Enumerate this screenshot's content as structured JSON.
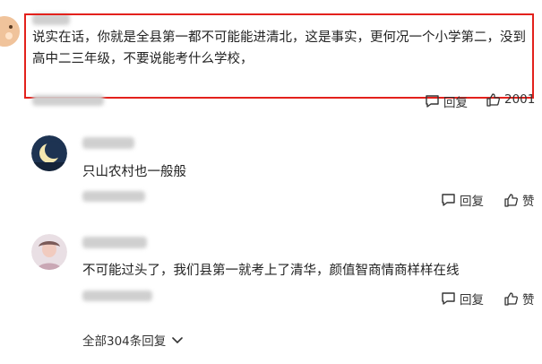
{
  "top_comment": {
    "text_line1": "说实在话，你就是全县第一都不可能能进清北，这是事实，更何况一个小学第二，没到",
    "text_line2": "高中二三年级，不要说能考什么学校，",
    "reply_label": "回复",
    "like_count": "2001"
  },
  "replies": [
    {
      "text": "只山农村也一般般",
      "reply_label": "回复",
      "like_label": "赞"
    },
    {
      "text": "不可能过头了，我们县第一就考上了清华，颜值智商情商样样在线",
      "reply_label": "回复",
      "like_label": "赞"
    }
  ],
  "more_replies": {
    "label": "全部304条回复"
  },
  "colors": {
    "highlight": "#e3211c",
    "text": "#222222",
    "icon": "#333333"
  }
}
